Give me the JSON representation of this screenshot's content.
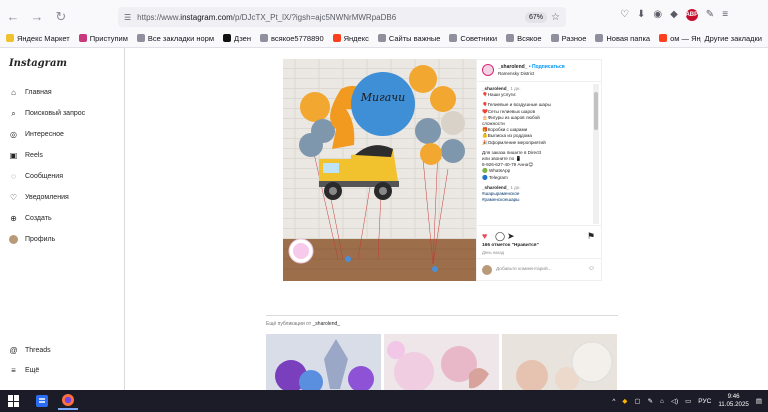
{
  "browser": {
    "url_prefix": "https://www.",
    "url_host": "instagram.com",
    "url_path": "/p/DJcTX_Pt_lX/?igsh=ajc5NWNrMWRpaDB6",
    "zoom": "67%",
    "bookmarks": [
      {
        "label": "Яндекс Маркет",
        "color": "#f2c12e"
      },
      {
        "label": "Приступим",
        "color": "#c7387c"
      },
      {
        "label": "Все закладки норм",
        "color": "#8f8f9d"
      },
      {
        "label": "Дзен",
        "color": "#111111"
      },
      {
        "label": "всякое5778890",
        "color": "#8f8f9d"
      },
      {
        "label": "Яндекс",
        "color": "#fc3f1d"
      },
      {
        "label": "Сайты важные",
        "color": "#8f8f9d"
      },
      {
        "label": "Советники",
        "color": "#8f8f9d"
      },
      {
        "label": "Всякое",
        "color": "#8f8f9d"
      },
      {
        "label": "Разное",
        "color": "#8f8f9d"
      },
      {
        "label": "Новая папка",
        "color": "#8f8f9d"
      },
      {
        "label": "ом — Яндекс: нашло...",
        "color": "#fc3f1d"
      }
    ],
    "other_bookmarks": "Другие закладки"
  },
  "sidebar": {
    "logo": "Instagram",
    "items": [
      {
        "label": "Главная",
        "icon": "home-icon"
      },
      {
        "label": "Поисковый запрос",
        "icon": "search-icon"
      },
      {
        "label": "Интересное",
        "icon": "compass-icon"
      },
      {
        "label": "Reels",
        "icon": "reels-icon"
      },
      {
        "label": "Сообщения",
        "icon": "messenger-icon"
      },
      {
        "label": "Уведомления",
        "icon": "heart-icon"
      },
      {
        "label": "Создать",
        "icon": "plus-icon"
      },
      {
        "label": "Профиль",
        "icon": "avatar-icon"
      }
    ],
    "threads": "Threads",
    "more": "Ещё"
  },
  "post": {
    "username": "_sharolend_",
    "follow": "• Подписаться",
    "location": "Ramensky District",
    "caption_user": "_sharolend_",
    "caption_time": "1 дн.",
    "caption_lines": [
      "🎈Наши услуги:",
      "",
      "🎈Гелиевые и воздушные шары",
      "❤️Сеты гелиевых шаров",
      "🎂Фигуры из шаров любой",
      "сложности",
      "🎁Коробки с шарами",
      "👶Выписка из роддома",
      "🎉Оформление мероприятий",
      "",
      "Для заказа пишите в Directt",
      "или звоните по 📱",
      "8-926-627-40-79 Анна😊",
      "🟢 WhatsApp",
      "🔵 Telegram"
    ],
    "second_time": "1 дн.",
    "hashtags": [
      "#шарыраменское",
      "#раменскоешары"
    ],
    "likes": "166 отметок \"Нравится\"",
    "date": "День назад",
    "comment_placeholder": "Добавьте комментарий..."
  },
  "more_posts": {
    "prefix": "Ещё публикации от",
    "user": "_sharolend_"
  },
  "taskbar": {
    "lang": "РУС",
    "time": "9:46",
    "date": "11.05.2025"
  },
  "balloon_text": "Мигачи"
}
